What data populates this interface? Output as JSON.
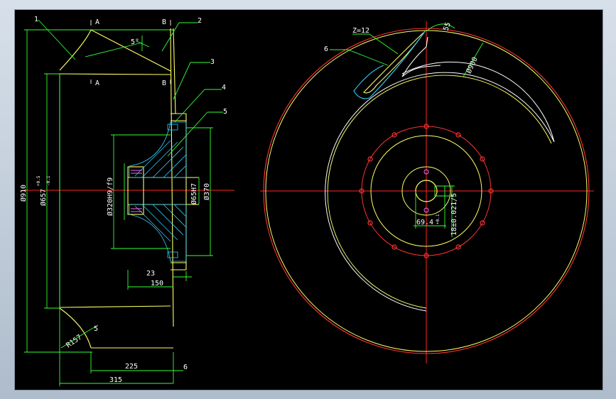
{
  "drawing": {
    "colors": {
      "background": "#000000",
      "outline": "#ffff66",
      "dimension": "#33ff33",
      "centerline": "#ff2222",
      "hatch": "#33ccff",
      "leader": "#33ff33",
      "circle_red": "#ff3333",
      "white_line": "#ffffff",
      "blade": "#ffff66",
      "cyan_blade": "#33ccff"
    },
    "side_view": {
      "part_labels": [
        "1",
        "2",
        "3",
        "4",
        "5",
        "6"
      ],
      "section_A": "A",
      "section_B": "B",
      "angle_label": "5°",
      "dim_910": "Ø910",
      "dim_657": "Ø657",
      "dim_657_tol_top": "+0.5",
      "dim_657_tol_bot": "-0.1",
      "dim_320": "Ø320H9/f9",
      "dim_65": "Ø65H7",
      "dim_370": "Ø370",
      "dim_23": "23",
      "dim_150": "150",
      "dim_R157": "R157",
      "dim_5": "5",
      "dim_225": "225",
      "dim_6": "6",
      "dim_315": "315"
    },
    "front_view": {
      "label_z12": "Z=12",
      "label_6": "6",
      "label_55": "55",
      "dim_900": "Ø900",
      "dim_694": "69.4",
      "dim_694_tol": "+0.1",
      "dim_18": "18±0.021/5"
    }
  }
}
